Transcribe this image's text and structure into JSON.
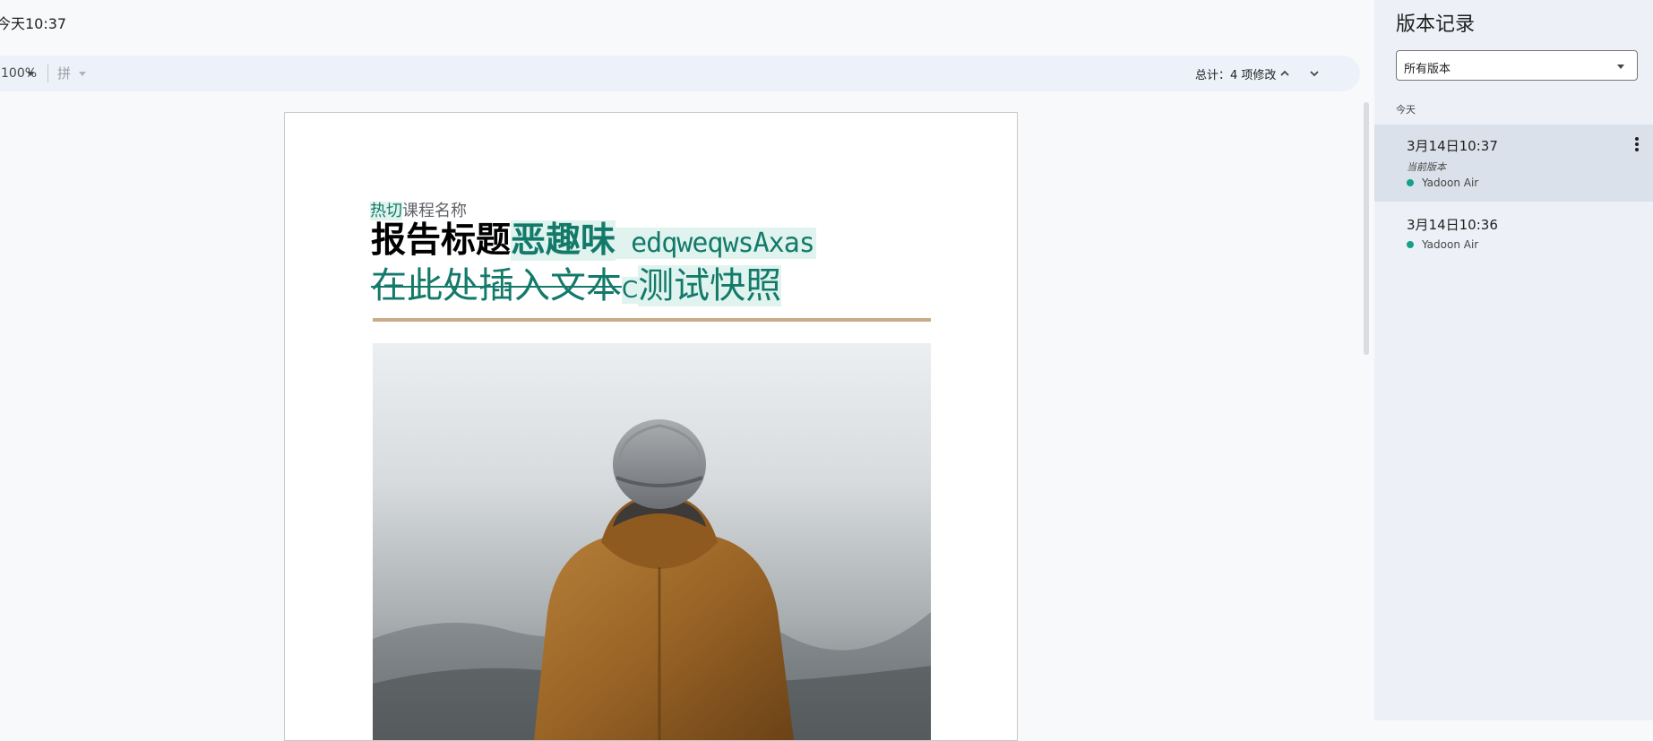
{
  "header": {
    "doc_time": "今天10:37"
  },
  "toolbar": {
    "zoom": "100%",
    "pinyin": "拼",
    "changes_summary": "总计：4 项修改"
  },
  "document": {
    "subtitle_ins": "热切",
    "subtitle_rest": "课程名称",
    "title_plain": "报告标题",
    "title_ins_bold": "恶趣味",
    "title_ins_latin": " edqweqwsAxas",
    "line2_deleted": "在此处插入文本",
    "line2_ins_prefix": "C",
    "line2_ins_text": "测试快照"
  },
  "panel": {
    "title": "版本记录",
    "filter_value": "所有版本",
    "section_today": "今天",
    "versions": [
      {
        "time": "3月14日10:37",
        "sub": "当前版本",
        "user": "Yadoon Air",
        "dot_color": "#14a08b"
      },
      {
        "time": "3月14日10:36",
        "user": "Yadoon Air",
        "dot_color": "#14a08b"
      }
    ]
  },
  "colors": {
    "insert_bg": "#e0f3ef",
    "insert_fg": "#137a6a",
    "selected_version_bg": "#dbe1ea",
    "rule": "#c9ab88"
  },
  "image": {
    "subject": "person-in-knit-hat-and-brown-jacket"
  }
}
